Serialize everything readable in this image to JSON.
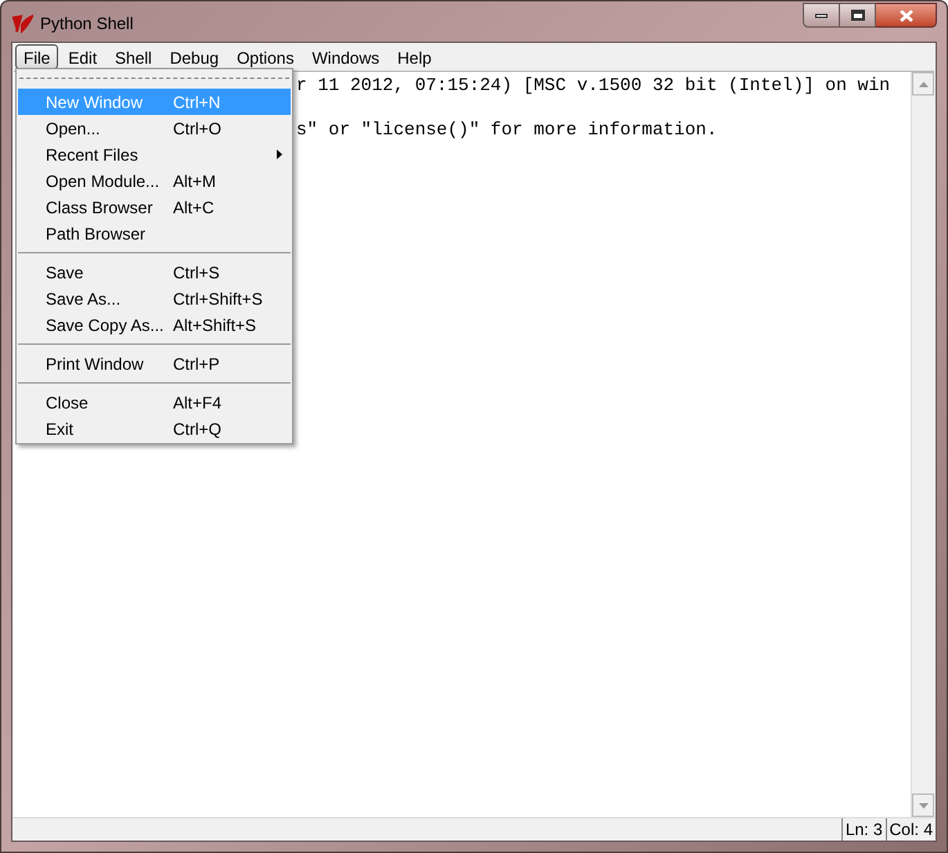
{
  "window": {
    "title": "Python Shell"
  },
  "menubar": [
    {
      "label": "File",
      "selected": true
    },
    {
      "label": "Edit",
      "selected": false
    },
    {
      "label": "Shell",
      "selected": false
    },
    {
      "label": "Debug",
      "selected": false
    },
    {
      "label": "Options",
      "selected": false
    },
    {
      "label": "Windows",
      "selected": false
    },
    {
      "label": "Help",
      "selected": false
    }
  ],
  "file_menu": [
    {
      "kind": "tearoff"
    },
    {
      "kind": "item",
      "label": "New Window",
      "shortcut": "Ctrl+N",
      "selected": true,
      "submenu": false
    },
    {
      "kind": "item",
      "label": "Open...",
      "shortcut": "Ctrl+O",
      "selected": false,
      "submenu": false
    },
    {
      "kind": "item",
      "label": "Recent Files",
      "selected": false,
      "submenu": true
    },
    {
      "kind": "item",
      "label": "Open Module...",
      "shortcut": "Alt+M",
      "selected": false,
      "submenu": false
    },
    {
      "kind": "item",
      "label": "Class Browser",
      "shortcut": "Alt+C",
      "selected": false,
      "submenu": false
    },
    {
      "kind": "item",
      "label": "Path Browser",
      "selected": false,
      "submenu": false
    },
    {
      "kind": "separator"
    },
    {
      "kind": "item",
      "label": "Save",
      "shortcut": "Ctrl+S",
      "selected": false,
      "submenu": false
    },
    {
      "kind": "item",
      "label": "Save As...",
      "shortcut": "Ctrl+Shift+S",
      "selected": false,
      "submenu": false
    },
    {
      "kind": "item",
      "label": "Save Copy As...",
      "shortcut": "Alt+Shift+S",
      "selected": false,
      "submenu": false
    },
    {
      "kind": "separator"
    },
    {
      "kind": "item",
      "label": "Print Window",
      "shortcut": "Ctrl+P",
      "selected": false,
      "submenu": false
    },
    {
      "kind": "separator"
    },
    {
      "kind": "item",
      "label": "Close",
      "shortcut": "Alt+F4",
      "selected": false,
      "submenu": false
    },
    {
      "kind": "item",
      "label": "Exit",
      "shortcut": "Ctrl+Q",
      "selected": false,
      "submenu": false
    }
  ],
  "shell_lines": [
    "r 11 2012, 07:15:24) [MSC v.1500 32 bit (Intel)] on win",
    "s\" or \"license()\" for more information."
  ],
  "status_bar": [
    "Ln: 3",
    "Col: 4"
  ]
}
